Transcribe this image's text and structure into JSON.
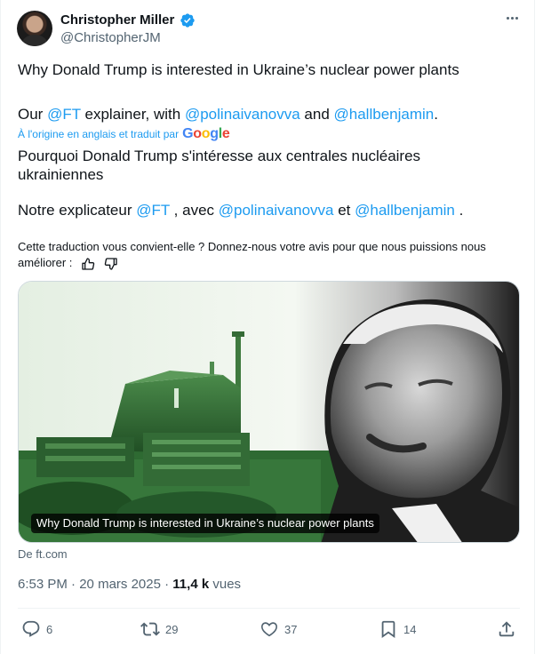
{
  "author": {
    "name": "Christopher Miller",
    "handle": "@ChristopherJM",
    "verified": true
  },
  "tweet": {
    "title": "Why Donald Trump is interested in Ukraine’s nuclear power plants",
    "line2_prefix": "Our ",
    "mention_ft": "@FT",
    "line2_mid": " explainer, with ",
    "mention_polina": "@polinaivanovva",
    "line2_and": " and ",
    "mention_ben": "@hallbenjamin",
    "line2_end": "."
  },
  "translation": {
    "label": "À l'origine en anglais et traduit par",
    "google": [
      "G",
      "o",
      "o",
      "g",
      "l",
      "e"
    ],
    "text1": "Pourquoi Donald Trump s'intéresse aux centrales nucléaires ukrainiennes",
    "text2_prefix": "Notre explicateur ",
    "mention_ft": "@FT",
    "text2_mid": " , avec ",
    "mention_polina": "@polinaivanovva",
    "text2_and": " et ",
    "mention_ben": "@hallbenjamin",
    "text2_end": " .",
    "feedback": "Cette traduction vous convient-elle ? Donnez-nous votre avis pour que nous puissions nous améliorer :"
  },
  "card": {
    "caption": "Why Donald Trump is interested in Ukraine’s nuclear power plants",
    "source": "De ft.com"
  },
  "meta": {
    "time": "6:53 PM",
    "separator": " · ",
    "date": "20 mars 2025",
    "views_count": "11,4 k",
    "views_label": " vues"
  },
  "actions": {
    "replies": "6",
    "reposts": "29",
    "likes": "37",
    "bookmarks": "14"
  },
  "colors": {
    "accent": "#1d9bf0",
    "muted": "#536471",
    "text": "#0f1419"
  }
}
